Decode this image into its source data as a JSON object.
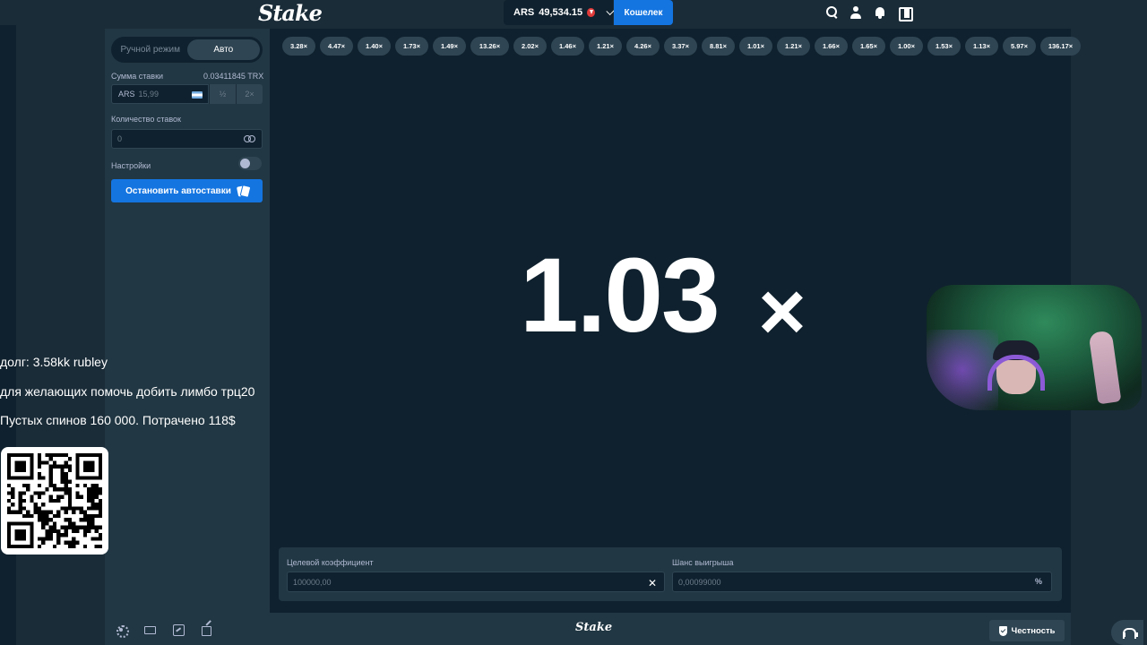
{
  "header": {
    "logo": "Stake",
    "balance_currency": "ARS",
    "balance_amount": "49,534.15",
    "wallet_label": "Кошелек"
  },
  "sidebar": {
    "tabs": [
      {
        "label": "Ручной режим",
        "active": false
      },
      {
        "label": "Авто",
        "active": true
      }
    ],
    "bet_amount_label": "Сумма ставки",
    "bet_amount_converted": "0.03411845 TRX",
    "bet_currency": "ARS",
    "bet_value": "15,99",
    "half_label": "½",
    "double_label": "2×",
    "bet_count_label": "Количество ставок",
    "bet_count_value": "0",
    "settings_label": "Настройки",
    "settings_enabled": false,
    "stop_autobet_label": "Остановить автоставки"
  },
  "history": [
    "3.28×",
    "4.47×",
    "1.40×",
    "1.73×",
    "1.49×",
    "13.26×",
    "2.02×",
    "1.46×",
    "1.21×",
    "4.26×",
    "3.37×",
    "8.81×",
    "1.01×",
    "1.21×",
    "1.66×",
    "1.65×",
    "1.00×",
    "1.53×",
    "1.13×",
    "5.97×",
    "136.17×"
  ],
  "game": {
    "result_value": "1.03",
    "result_suffix": "×"
  },
  "controls": {
    "target_label": "Целевой коэффициент",
    "target_value": "100000,00",
    "chance_label": "Шанс выигрыша",
    "chance_value": "0,00099000",
    "chance_suffix": "%"
  },
  "footer": {
    "logo": "Stake",
    "fairness_label": "Честность"
  },
  "overlay": {
    "line1": "долг: 3.58kk rubley",
    "line2": "для желающих помочь добить лимбо трц20",
    "line3": "Пустых спинов 160 000. Потрачено 118$"
  },
  "colors": {
    "background": "#1a2c38",
    "panel": "#213743",
    "canvas": "#0f212e",
    "accent_blue": "#1475e1",
    "pill": "#2f4553"
  }
}
